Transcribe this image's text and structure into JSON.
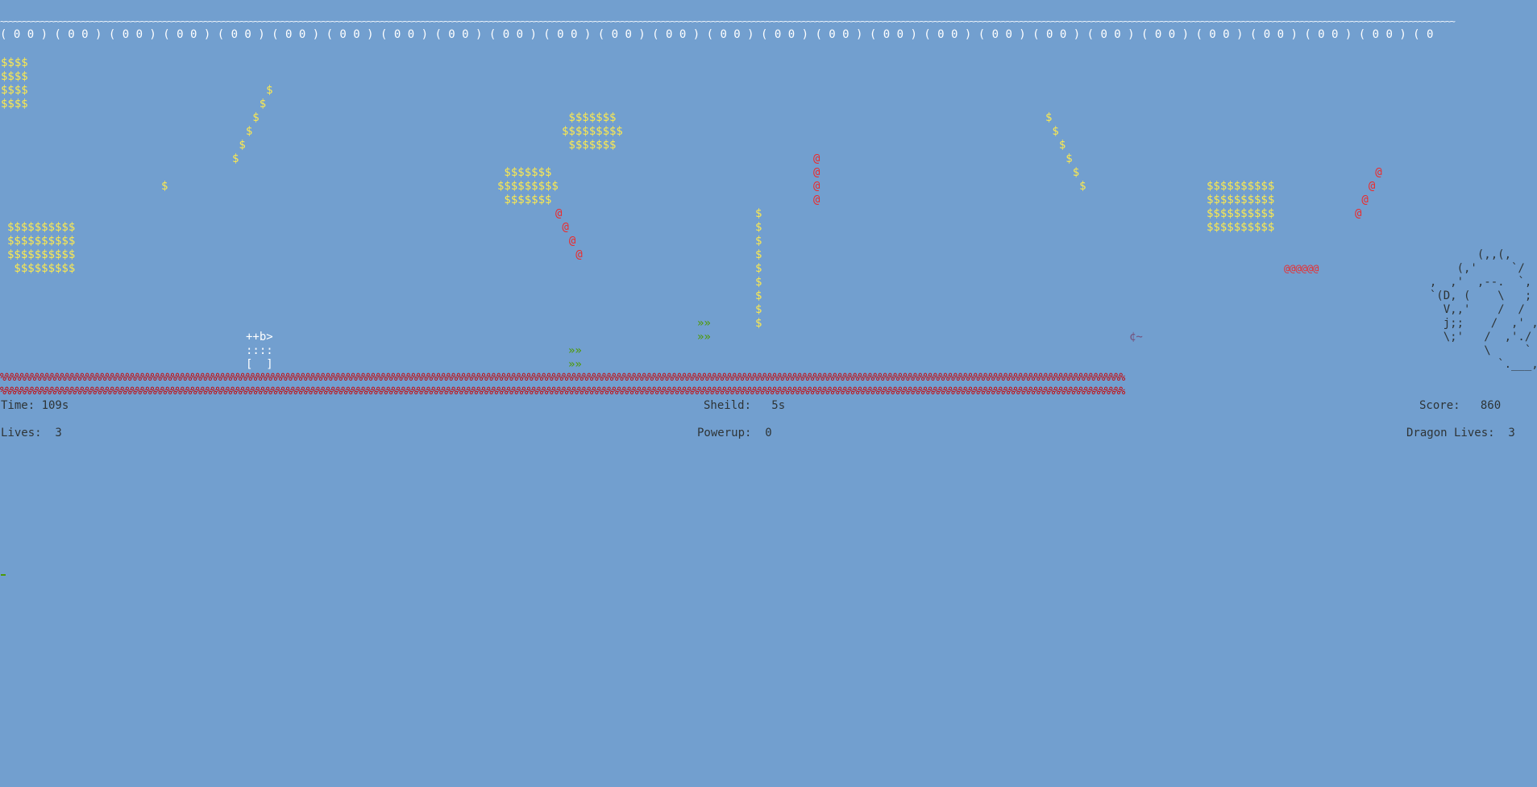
{
  "board": {
    "ceiling_line": "~~~~~~~~~~~~~~~~~~~~~~~~~~~~~~~~~~~~~~~~~~~~~~~~~~~~~~~~~~~~~~~~~~~~~~~~~~~~~~~~~~~~~~~~~~~~~~~~~~~~~~~~~~~~~~~~~~~~~~~~~~~~~~~~~~~~~~~~~~~~~~~~~~~~~~~~~~~~~~~~~~~~~~~~~~~~~~~~~~~~~~~~~~~~~~~~~~~~~~~~~~~~~~~~~~~~~~~~~~~~~~~~~~~~~~~~~~~~~~~~~~~~~~~~~~~~~~~~~~~~~~~~~~~~~~~~~~~~~~~~~~~~~~~~~~~~~~~~~~~~~~~~~~~~~~~~~~~~~~~~~",
    "ceiling_clouds": "( 0 0 ) ( 0 0 ) ( 0 0 ) ( 0 0 ) ( 0 0 ) ( 0 0 ) ( 0 0 ) ( 0 0 ) ( 0 0 ) ( 0 0 ) ( 0 0 ) ( 0 0 ) ( 0 0 ) ( 0 0 ) ( 0 0 ) ( 0 0 ) ( 0 0 ) ( 0 0 ) ( 0 0 ) ( 0 0 ) ( 0 0 ) ( 0 0 ) ( 0 0 ) ( 0 0 ) ( 0 0 ) ( 0 0 ) ( 0",
    "floor_row_1": "%%%%%%%%%%%%%%%%%%%%%%%%%%%%%%%%%%%%%%%%%%%%%%%%%%%%%%%%%%%%%%%%%%%%%%%%%%%%%%%%%%%%%%%%%%%%%%%%%%%%%%%%%%%%%%%%%%%%%%%%%%%%%%%%%%%%%%%%%%%%%%%%%%%%%%%%%%%%%%%%%%%%%%%%%%%%%%%%%%%%%%%%%%%%%%%%%%%%%%%%%%%%%%%%%%%%%%%%%%%%%%%%",
    "floor_row_2": "%%%%%%%%%%%%%%%%%%%%%%%%%%%%%%%%%%%%%%%%%%%%%%%%%%%%%%%%%%%%%%%%%%%%%%%%%%%%%%%%%%%%%%%%%%%%%%%%%%%%%%%%%%%%%%%%%%%%%%%%%%%%%%%%%%%%%%%%%%%%%%%%%%%%%%%%%%%%%%%%%%%%%%%%%%%%%%%%%%%%%%%%%%%%%%%%%%%%%%%%%%%%%%%%%%%%%%%%%%%%%%%%"
  },
  "coins": {
    "block_top_left": "$$$$\n$$$$\n$$$$\n$$$$",
    "block_left": "$$$$$$$$$$\n$$$$$$$$$$\n$$$$$$$$$$\n $$$$$$$$$",
    "diag_1": "     $\n    $\n   $\n  $\n $\n$",
    "single": "$",
    "cluster_mid_top": " $$$$$$$\n$$$$$$$$$\n $$$$$$$",
    "cluster_mid": " $$$$$$$\n$$$$$$$$$\n $$$$$$$",
    "column_1": "$\n$\n$\n$\n$\n$\n$\n$\n$",
    "diag_2": "$\n $\n  $\n   $\n    $\n     $",
    "block_right": "$$$$$$$$$$\n$$$$$$$$$$\n$$$$$$$$$$\n$$$$$$$$$$"
  },
  "obstacles": {
    "diag_a": "@\n @\n  @\n   @",
    "column_a": "@\n@\n@\n@",
    "diag_b": "   @\n  @\n @\n@",
    "row_a": "@@@@@@"
  },
  "powerups": {
    "boost_1": "»»\n»»",
    "boost_2": "»»\n»»"
  },
  "player": {
    "sprite": "++b>\n::::\n[  ]"
  },
  "enemies": {
    "dragon_fire": "¢~",
    "dragon": "         (,,(,\n      (,'     `/\n  ,  ,'  ,--.  `,\n  `(D, (    \\   ;\n    V,,'    /  /\n    j;;    /  ,' ,\n    \\;'   /  ,'./\n          \\     `\n            `.___,'"
  },
  "hud": {
    "time": "Time: 109s",
    "shield": "Sheild:   5s",
    "score": "Score:   860",
    "lives": "Lives:  3",
    "powerup": "Powerup:  0",
    "dragon_lives": "Dragon Lives:  3"
  },
  "colors": {
    "background": "#729fcf",
    "coin": "#fce94f",
    "obstacle": "#ef2929",
    "floor": "#cc0000",
    "powerup": "#4e9a06",
    "hud_text": "#2e3436"
  }
}
